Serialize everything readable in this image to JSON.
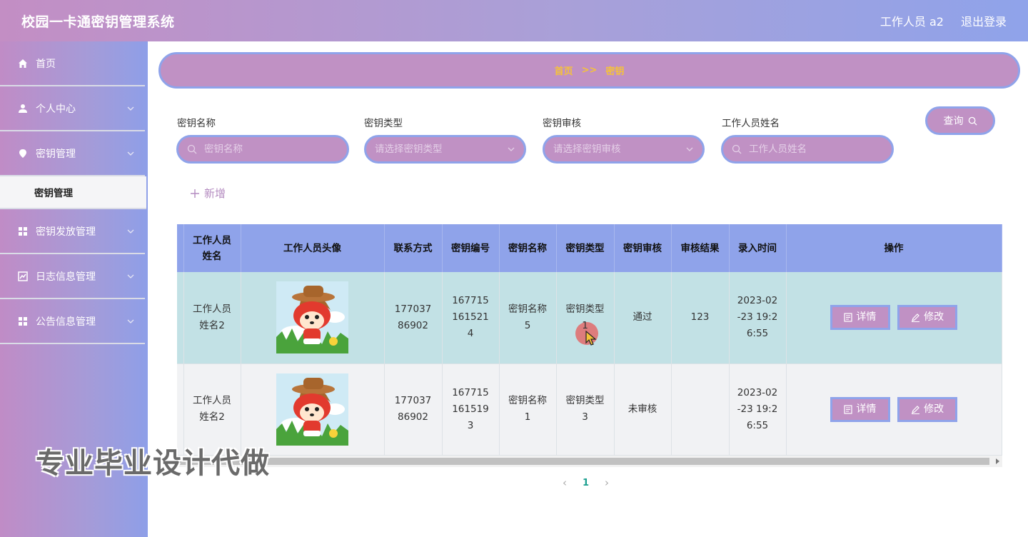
{
  "header": {
    "title": "校园一卡通密钥管理系统",
    "user": "工作人员 a2",
    "logout": "退出登录"
  },
  "sidebar": {
    "items": [
      {
        "label": "首页",
        "icon": "home-icon"
      },
      {
        "label": "个人中心",
        "icon": "user-icon"
      },
      {
        "label": "密钥管理",
        "icon": "location-icon"
      },
      {
        "label": "密钥发放管理",
        "icon": "grid-icon"
      },
      {
        "label": "日志信息管理",
        "icon": "chart-icon"
      },
      {
        "label": "公告信息管理",
        "icon": "grid-icon"
      }
    ],
    "submenu_active": "密钥管理"
  },
  "breadcrumb": {
    "home": "首页",
    "separator": ">>",
    "current": "密钥"
  },
  "search": {
    "fields": [
      {
        "label": "密钥名称",
        "placeholder": "密钥名称"
      },
      {
        "label": "密钥类型",
        "placeholder": "请选择密钥类型"
      },
      {
        "label": "密钥审核",
        "placeholder": "请选择密钥审核"
      },
      {
        "label": "工作人员姓名",
        "placeholder": "工作人员姓名"
      }
    ],
    "query_label": "查询"
  },
  "add_label": "新增",
  "table": {
    "headers": [
      "工作人员姓名",
      "工作人员头像",
      "联系方式",
      "密钥编号",
      "密钥名称",
      "密钥类型",
      "密钥审核",
      "审核结果",
      "录入时间",
      "操作"
    ],
    "rows": [
      {
        "name": "工作人员姓名2",
        "phone": "17703786902",
        "key_no": "1677151615214",
        "key_name": "密钥名称5",
        "key_type": "密钥类型",
        "key_type_suffix": "1",
        "audit": "通过",
        "result": "123",
        "time": "2023-02-23 19:26:55"
      },
      {
        "name": "工作人员姓名2",
        "phone": "17703786902",
        "key_no": "1677151615193",
        "key_name": "密钥名称1",
        "key_type": "密钥类型3",
        "key_type_suffix": "",
        "audit": "未审核",
        "result": "",
        "time": "2023-02-23 19:26:55"
      }
    ],
    "detail_label": "详情",
    "edit_label": "修改"
  },
  "pagination": {
    "current": "1"
  },
  "watermark": "专业毕业设计代做",
  "colors": {
    "accent": "#c091c4",
    "border": "#8fa3ea",
    "breadcrumb_text": "#f5c23a",
    "row_highlight": "#c2e1e5"
  }
}
